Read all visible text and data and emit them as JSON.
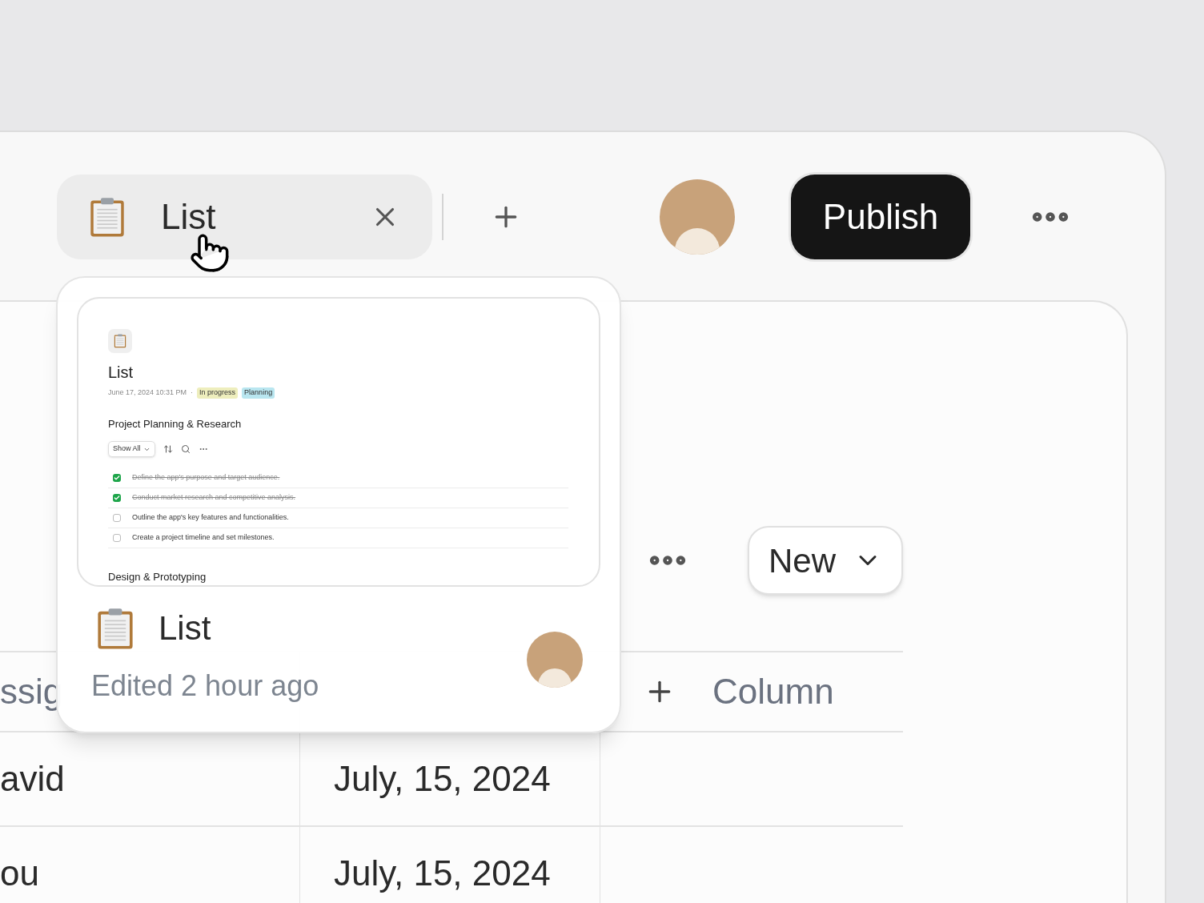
{
  "tab": {
    "title": "List"
  },
  "publish_button": {
    "label": "Publish"
  },
  "toolbar": {
    "new_button": {
      "label": "New"
    }
  },
  "table": {
    "columns": [
      {
        "label": "ssig"
      },
      {
        "label": "Column",
        "kind": "add"
      }
    ],
    "rows": [
      {
        "cells": [
          "avid",
          "July, 15, 2024"
        ]
      },
      {
        "cells": [
          "ou",
          "July, 15, 2024"
        ]
      }
    ]
  },
  "preview_card": {
    "doc_title": "List",
    "timestamp": "June 17, 2024 10:31 PM",
    "separator": "·",
    "tags": [
      {
        "label": "In progress",
        "color": "#eeeebd"
      },
      {
        "label": "Planning",
        "color": "#b9e6f0"
      }
    ],
    "section_title": "Project Planning & Research",
    "filter": "Show All",
    "tasks": [
      {
        "text": "Define the app's purpose and target audience.",
        "checked": true
      },
      {
        "text": "Conduct market research and competitive analysis.",
        "checked": true
      },
      {
        "text": "Outline the app's key features and functionalities.",
        "checked": false
      },
      {
        "text": "Create a project timeline and set milestones.",
        "checked": false
      }
    ],
    "next_section_title": "Design & Prototyping",
    "title": "List",
    "subtitle": "Edited 2 hour ago"
  }
}
